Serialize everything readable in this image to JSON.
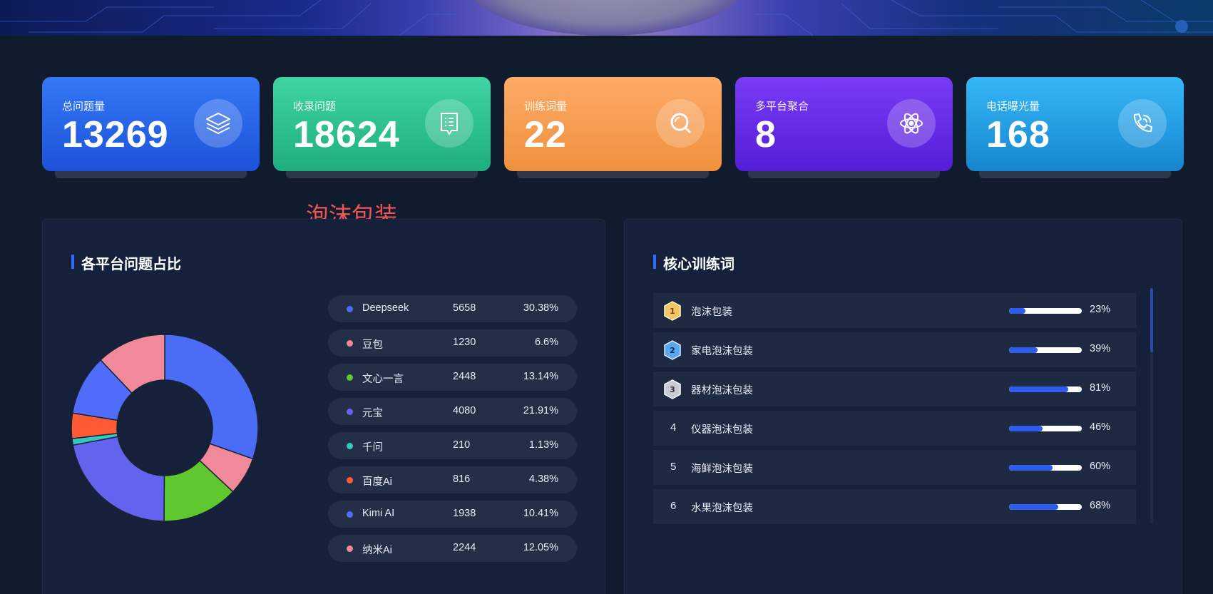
{
  "stats": [
    {
      "label": "总问题量",
      "value": "13269",
      "icon": "layers-icon"
    },
    {
      "label": "收录问题",
      "value": "18624",
      "icon": "document-list-icon"
    },
    {
      "label": "训练词量",
      "value": "22",
      "icon": "search-icon"
    },
    {
      "label": "多平台聚合",
      "value": "8",
      "icon": "atom-icon"
    },
    {
      "label": "电话曝光量",
      "value": "168",
      "icon": "phone-icon"
    }
  ],
  "floating_label": "泡沫包装",
  "platform_panel": {
    "title": "各平台问题占比",
    "items": [
      {
        "name": "Deepseek",
        "count": "5658",
        "percent": "30.38%",
        "color": "#4a6cf7"
      },
      {
        "name": "豆包",
        "count": "1230",
        "percent": "6.6%",
        "color": "#f08a9a"
      },
      {
        "name": "文心一言",
        "count": "2448",
        "percent": "13.14%",
        "color": "#5ec82e"
      },
      {
        "name": "元宝",
        "count": "4080",
        "percent": "21.91%",
        "color": "#6363ef"
      },
      {
        "name": "千问",
        "count": "210",
        "percent": "1.13%",
        "color": "#36c6c0"
      },
      {
        "name": "百度Ai",
        "count": "816",
        "percent": "4.38%",
        "color": "#ff5a36"
      },
      {
        "name": "Kimi AI",
        "count": "1938",
        "percent": "10.41%",
        "color": "#4f6dfa"
      },
      {
        "name": "纳米Ai",
        "count": "2244",
        "percent": "12.05%",
        "color": "#f08a9a"
      }
    ]
  },
  "keywords_panel": {
    "title": "核心训练词",
    "items": [
      {
        "rank": "1",
        "name": "泡沫包装",
        "percent": "23%",
        "value": 0.23,
        "badge": "gold"
      },
      {
        "rank": "2",
        "name": "家电泡沫包装",
        "percent": "39%",
        "value": 0.39,
        "badge": "blue"
      },
      {
        "rank": "3",
        "name": "器材泡沫包装",
        "percent": "81%",
        "value": 0.81,
        "badge": "silver"
      },
      {
        "rank": "4",
        "name": "仪器泡沫包装",
        "percent": "46%",
        "value": 0.46,
        "badge": ""
      },
      {
        "rank": "5",
        "name": "海鲜泡沫包装",
        "percent": "60%",
        "value": 0.6,
        "badge": ""
      },
      {
        "rank": "6",
        "name": "水果泡沫包装",
        "percent": "68%",
        "value": 0.68,
        "badge": ""
      }
    ]
  }
}
